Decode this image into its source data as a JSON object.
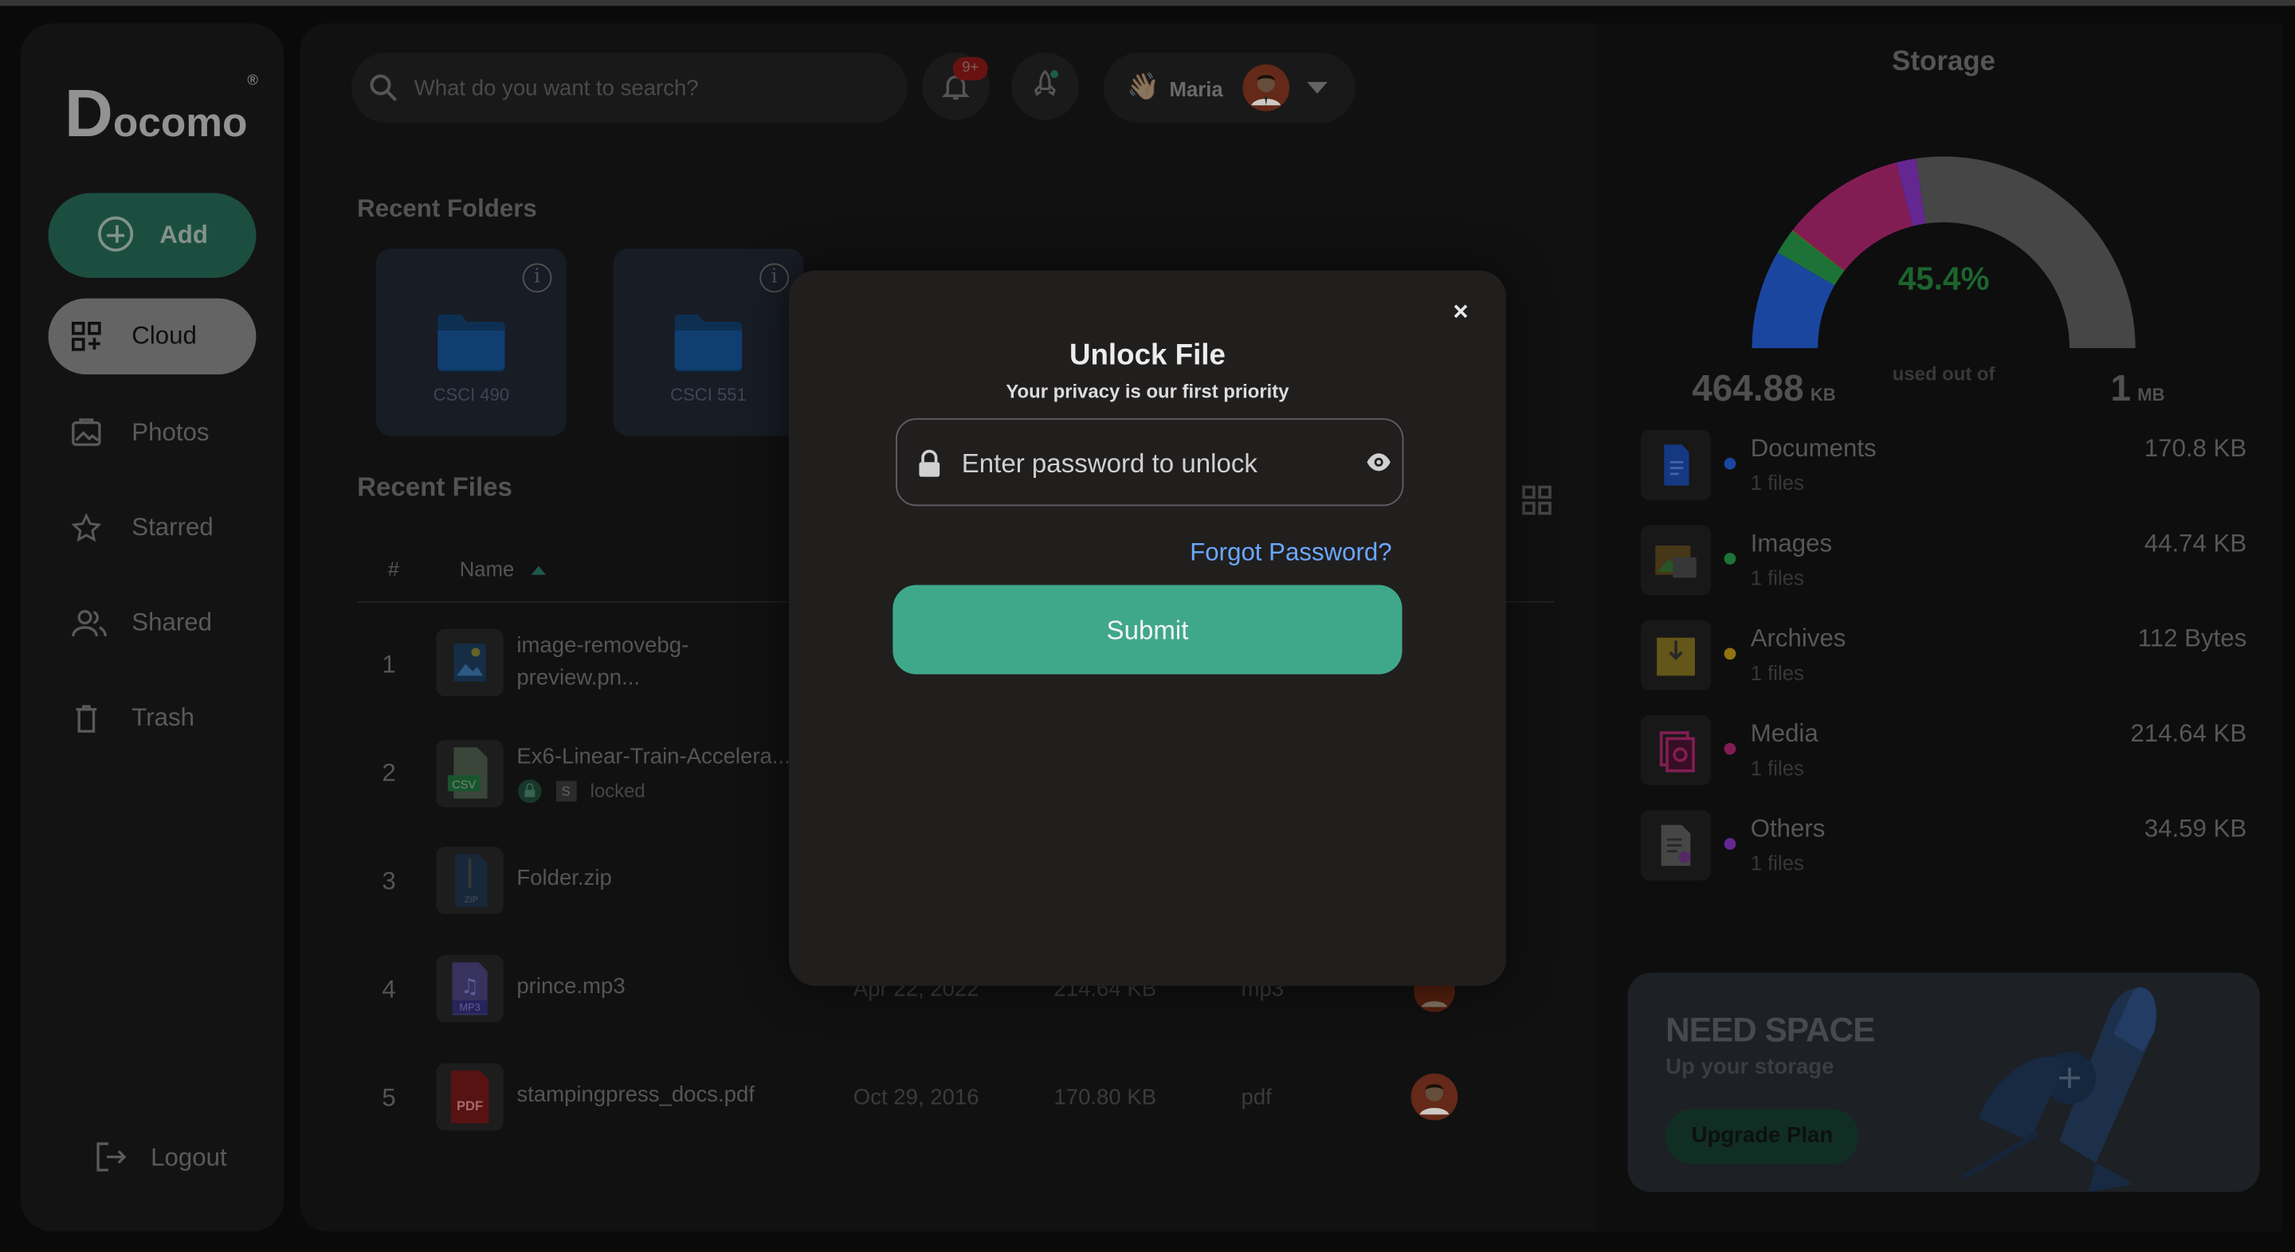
{
  "app": {
    "logo_text": "ocomo",
    "logo_initial": "D",
    "logo_mark": "®"
  },
  "sidebar": {
    "add_label": "Add",
    "items": [
      {
        "label": "Cloud",
        "icon": "cloud-grid-icon",
        "active": true
      },
      {
        "label": "Photos",
        "icon": "photos-icon"
      },
      {
        "label": "Starred",
        "icon": "star-icon"
      },
      {
        "label": "Shared",
        "icon": "shared-users-icon"
      },
      {
        "label": "Trash",
        "icon": "trash-icon"
      }
    ],
    "logout_label": "Logout"
  },
  "header": {
    "search_placeholder": "What do you want to search?",
    "notification_badge": "9+",
    "greeting_emoji": "👋🏼",
    "user_name": "Maria"
  },
  "recent_folders": {
    "title": "Recent Folders",
    "items": [
      {
        "name": "CSCI 490"
      },
      {
        "name": "CSCI 551"
      }
    ]
  },
  "recent_files": {
    "title": "Recent Files",
    "columns": {
      "num": "#",
      "name": "Name"
    },
    "rows": [
      {
        "num": "1",
        "name_line1": "image-removebg-",
        "name_line2": "preview.pn...",
        "type_icon": "image-file-icon"
      },
      {
        "num": "2",
        "name_line1": "Ex6-Linear-Train-Accelera...",
        "type_icon": "csv-file-icon",
        "type_label": "CSV",
        "lock_label": "locked",
        "lock_badge": "S"
      },
      {
        "num": "3",
        "name_line1": "Folder.zip",
        "type_icon": "zip-file-icon",
        "type_label": "ZIP"
      },
      {
        "num": "4",
        "name_line1": "prince.mp3",
        "type_icon": "mp3-file-icon",
        "type_label": "MP3",
        "date": "Apr 22, 2022",
        "size": "214.64 KB",
        "ext": "mp3"
      },
      {
        "num": "5",
        "name_line1": "stampingpress_docs.pdf",
        "type_icon": "pdf-file-icon",
        "type_label": "PDF",
        "date": "Oct 29, 2016",
        "size": "170.80 KB",
        "ext": "pdf"
      }
    ]
  },
  "storage": {
    "title": "Storage",
    "percent_label": "45.4%",
    "percent_used": 0.454,
    "used_value": "464.88",
    "used_unit": "KB",
    "used_out_of_label": "used out of",
    "total_value": "1",
    "total_unit": "MB",
    "categories": [
      {
        "name": "Documents",
        "count": "1 files",
        "size": "170.8 KB",
        "color": "#1d4aa8",
        "icon": "documents-icon"
      },
      {
        "name": "Images",
        "count": "1 files",
        "size": "44.74 KB",
        "color": "#1f7a3a",
        "icon": "images-icon"
      },
      {
        "name": "Archives",
        "count": "1 files",
        "size": "112 Bytes",
        "color": "#9a7a10",
        "icon": "archives-icon"
      },
      {
        "name": "Media",
        "count": "1 files",
        "size": "214.64 KB",
        "color": "#8a1f58",
        "icon": "media-icon"
      },
      {
        "name": "Others",
        "count": "1 files",
        "size": "34.59 KB",
        "color": "#6a2a9a",
        "icon": "others-icon"
      }
    ],
    "promo": {
      "heading": "NEED SPACE",
      "subheading": "Up your storage",
      "button": "Upgrade Plan"
    }
  },
  "modal": {
    "title": "Unlock File",
    "subtitle": "Your privacy is our first priority",
    "password_placeholder": "Enter password to unlock",
    "password_value": "",
    "forgot_label": "Forgot Password?",
    "submit_label": "Submit",
    "close_glyph": "×"
  }
}
